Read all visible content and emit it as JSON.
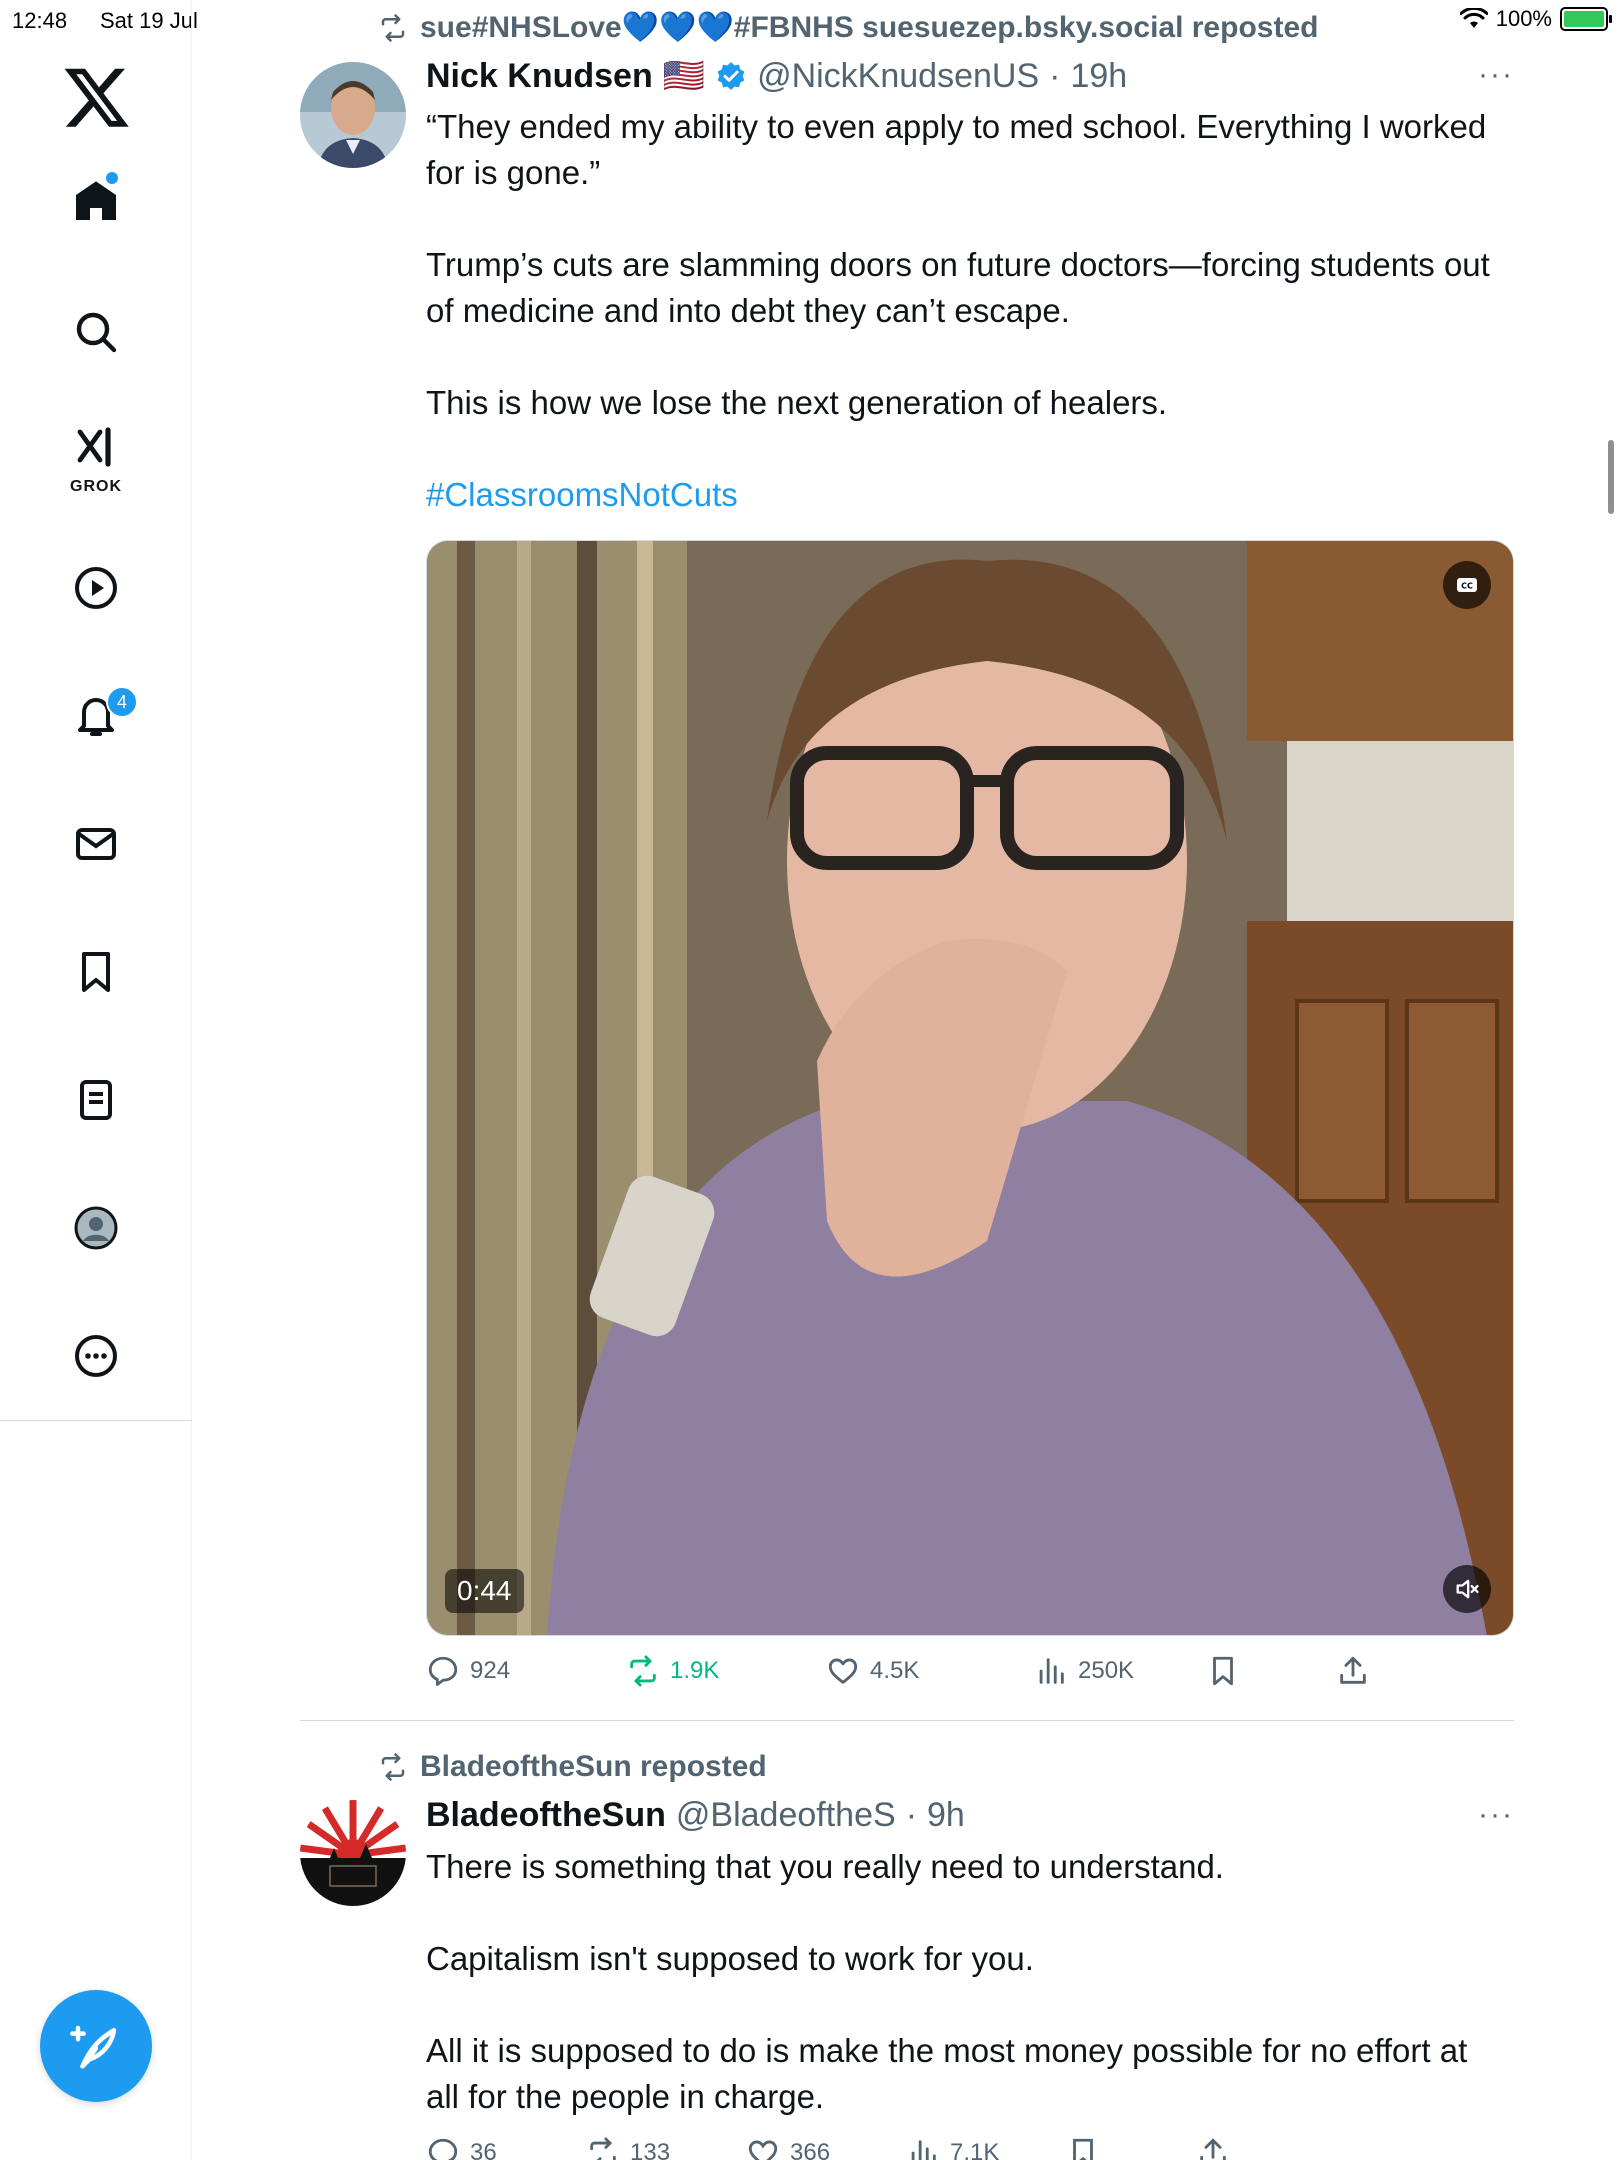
{
  "status": {
    "time": "12:48",
    "date": "Sat 19 Jul",
    "battery": "100%"
  },
  "sidebar": {
    "grok_label": "GROK",
    "notifications_count": "4",
    "items": [
      "x-logo",
      "home",
      "search",
      "grok",
      "video",
      "notifications",
      "messages",
      "bookmarks",
      "lists",
      "profile",
      "more"
    ]
  },
  "tweets": [
    {
      "repost_text": "sue#NHSLove💙💙💙#FBNHS suesuezep.bsky.social reposted",
      "display_name": "Nick Knudsen",
      "flag": "🇺🇸",
      "handle": "@NickKnudsenUS",
      "separator": "·",
      "time": "19h",
      "more": "···",
      "paragraphs": [
        "“They ended my ability to even apply to med school. Everything I worked for is gone.”",
        "Trump’s cuts are slamming doors on future doctors—forcing students out of medicine and into debt they can’t escape.",
        "This is how we lose the next generation of healers."
      ],
      "hashtag": "#ClassroomsNotCuts",
      "video_duration": "0:44",
      "stats": {
        "replies": "924",
        "reposts": "1.9K",
        "likes": "4.5K",
        "views": "250K"
      }
    },
    {
      "repost_text": "BladeoftheSun reposted",
      "display_name": "BladeoftheSun",
      "handle": "@BladeoftheS",
      "separator": "·",
      "time": "9h",
      "more": "···",
      "paragraphs": [
        "There is something that you really need to understand.",
        "Capitalism isn't supposed to work for you.",
        "All it is supposed to do is make the most money possible for no effort at all for the people in charge."
      ],
      "stats": {
        "replies": "36",
        "reposts": "133",
        "likes": "366",
        "views": "7.1K"
      }
    }
  ],
  "colors": {
    "accent": "#1d9bf0",
    "repost_green": "#00ba7c",
    "muted": "#536471"
  }
}
